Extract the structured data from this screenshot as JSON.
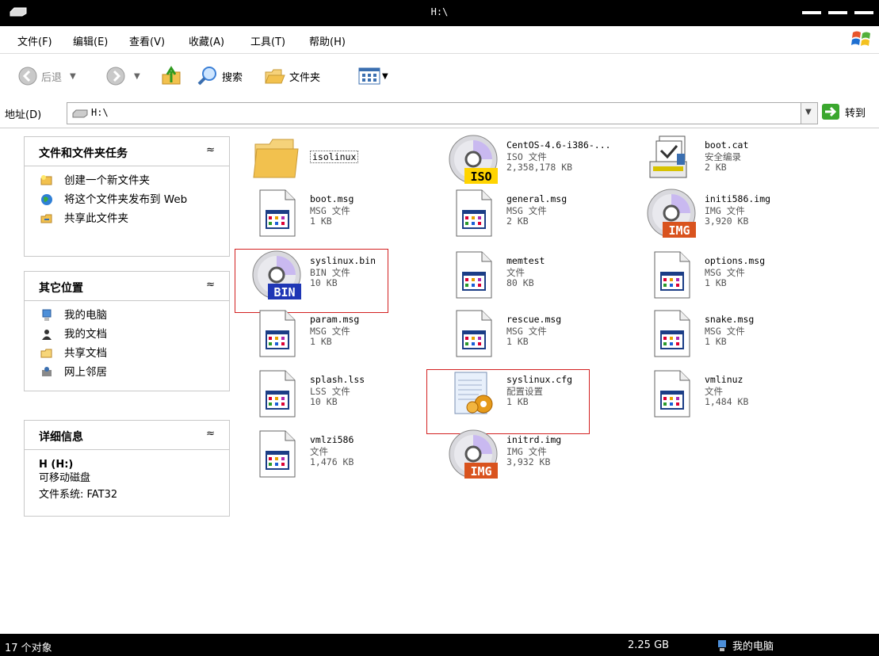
{
  "window": {
    "title": "H:\\"
  },
  "menu": [
    "文件(F)",
    "编辑(E)",
    "查看(V)",
    "收藏(A)",
    "工具(T)",
    "帮助(H)"
  ],
  "toolbar": {
    "back": "后退",
    "search": "搜索",
    "folders": "文件夹"
  },
  "address": {
    "label": "地址(D)",
    "value": "H:\\",
    "go": "转到"
  },
  "panels": {
    "tasks": {
      "title": "文件和文件夹任务",
      "items": [
        "创建一个新文件夹",
        "将这个文件夹发布到 Web",
        "共享此文件夹"
      ]
    },
    "places": {
      "title": "其它位置",
      "items": [
        "我的电脑",
        "我的文档",
        "共享文档",
        "网上邻居"
      ]
    },
    "details": {
      "title": "详细信息",
      "name": "H (H:)",
      "type": "可移动磁盘",
      "fs": "文件系统: FAT32"
    }
  },
  "files": [
    {
      "name": "isolinux",
      "type": "",
      "size": "",
      "icon": "folder-icon"
    },
    {
      "name": "CentOS-4.6-i386-...",
      "type": "ISO 文件",
      "size": "2,358,178 KB",
      "icon": "iso-disc-icon"
    },
    {
      "name": "boot.cat",
      "type": "安全编录",
      "size": "2 KB",
      "icon": "catalog-icon"
    },
    {
      "name": "boot.msg",
      "type": "MSG 文件",
      "size": "1 KB",
      "icon": "generic-file-icon"
    },
    {
      "name": "general.msg",
      "type": "MSG 文件",
      "size": "2 KB",
      "icon": "generic-file-icon"
    },
    {
      "name": "initi586.img",
      "type": "IMG 文件",
      "size": "3,920 KB",
      "icon": "img-disc-icon"
    },
    {
      "name": "syslinux.bin",
      "type": "BIN 文件",
      "size": "10 KB",
      "icon": "bin-disc-icon"
    },
    {
      "name": "memtest",
      "type": "文件",
      "size": "80 KB",
      "icon": "generic-file-icon"
    },
    {
      "name": "options.msg",
      "type": "MSG 文件",
      "size": "1 KB",
      "icon": "generic-file-icon"
    },
    {
      "name": "param.msg",
      "type": "MSG 文件",
      "size": "1 KB",
      "icon": "generic-file-icon"
    },
    {
      "name": "rescue.msg",
      "type": "MSG 文件",
      "size": "1 KB",
      "icon": "generic-file-icon"
    },
    {
      "name": "snake.msg",
      "type": "MSG 文件",
      "size": "1 KB",
      "icon": "generic-file-icon"
    },
    {
      "name": "splash.lss",
      "type": "LSS 文件",
      "size": "10 KB",
      "icon": "generic-file-icon"
    },
    {
      "name": "syslinux.cfg",
      "type": "配置设置",
      "size": "1 KB",
      "icon": "config-file-icon"
    },
    {
      "name": "vmlinuz",
      "type": "文件",
      "size": "1,484 KB",
      "icon": "generic-file-icon"
    },
    {
      "name": "vmlzi586",
      "type": "文件",
      "size": "1,476 KB",
      "icon": "generic-file-icon"
    },
    {
      "name": "initrd.img",
      "type": "IMG 文件",
      "size": "3,932 KB",
      "icon": "img-disc-icon"
    }
  ],
  "status": {
    "count": "17 个对象",
    "size": "2.25 GB",
    "location": "我的电脑"
  }
}
